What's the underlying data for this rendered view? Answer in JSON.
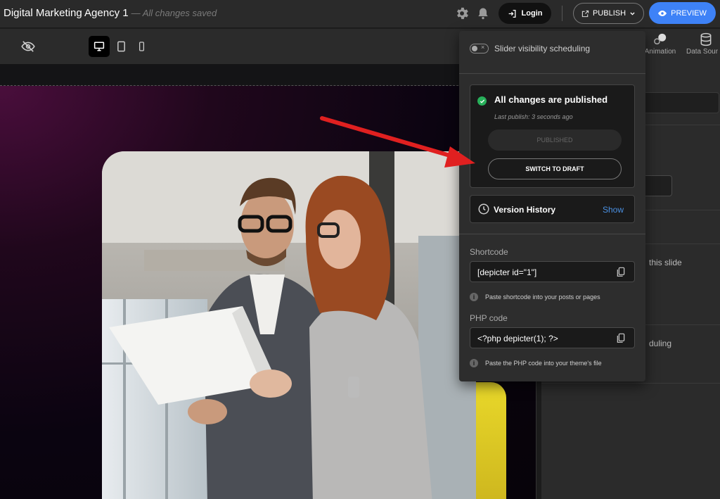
{
  "topbar": {
    "title": "Digital Marketing Agency 1",
    "status": "— All changes saved",
    "login_label": "Login",
    "publish_label": "PUBLISH",
    "preview_label": "PREVIEW",
    "icons": [
      "gear-icon",
      "bell-icon",
      "login-icon",
      "external-link-icon",
      "chevron-down-icon",
      "eye-icon"
    ]
  },
  "toolbar": {
    "tabs": [
      {
        "label": "Animation",
        "icon": "animation-icon"
      },
      {
        "label": "Data Sour",
        "icon": "database-icon"
      }
    ]
  },
  "right_panel": {
    "text_1": "this slide",
    "text_2": "duling"
  },
  "popover": {
    "scheduling_label": "Slider visibility scheduling",
    "status_title": "All changes are published",
    "last_publish": "Last publish: 3 seconds ago",
    "published_button": "PUBLISHED",
    "switch_button": "SWITCH TO DRAFT",
    "version_history_label": "Version History",
    "version_history_action": "Show",
    "shortcode_label": "Shortcode",
    "shortcode_value": "[depicter id=\"1\"]",
    "shortcode_hint": "Paste shortcode into your posts or pages",
    "php_label": "PHP code",
    "php_value": "<?php depicter(1); ?>",
    "php_hint": "Paste the PHP code into your theme's file"
  },
  "colors": {
    "accent_blue": "#3e82f7",
    "success_green": "#27b05a",
    "annotation_red": "#e02020",
    "link_blue": "#4a90e2"
  }
}
